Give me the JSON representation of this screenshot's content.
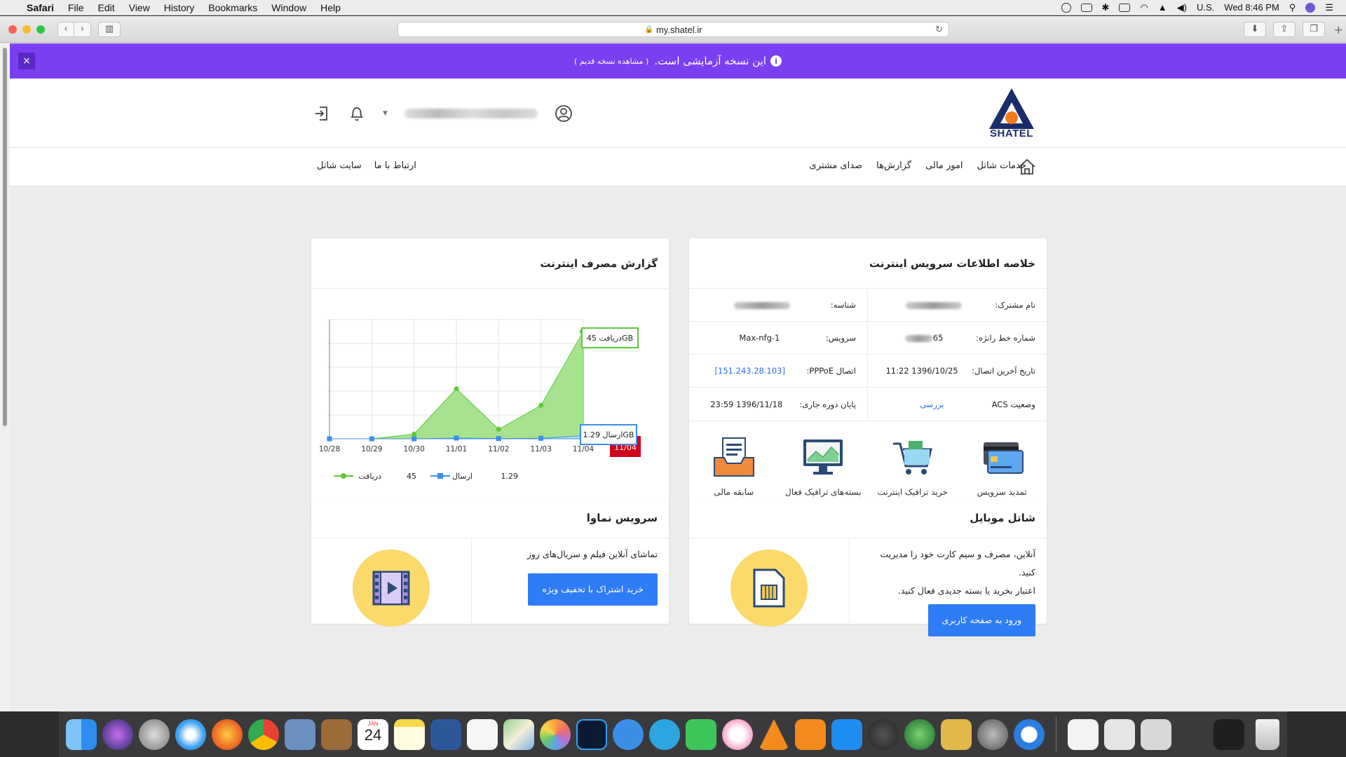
{
  "menubar": {
    "items": [
      "Safari",
      "File",
      "Edit",
      "View",
      "History",
      "Bookmarks",
      "Window",
      "Help"
    ],
    "input_source": "U.S.",
    "clock": "Wed 8:46 PM"
  },
  "browser": {
    "url": "my.shatel.ir"
  },
  "banner": {
    "text": "این نسخه آزمایشی است.",
    "old_version_link": "( مشاهده نسخه قدیم )",
    "close": "×"
  },
  "header": {
    "logo_text": "SHATEL"
  },
  "nav": {
    "main": [
      "خدمات شاتل",
      "امور مالی",
      "گزارش‌ها",
      "صدای مشتری"
    ],
    "side": [
      "ارتباط با ما",
      "سایت شاتل"
    ]
  },
  "service_info": {
    "title": "خلاصه اطلاعات سرویس اینترنت",
    "rows": [
      [
        {
          "label": "نام مشترک:",
          "value": ""
        },
        {
          "label": "شناسه:",
          "value": ""
        }
      ],
      [
        {
          "label": "شماره خط رانژه:",
          "value": "65"
        },
        {
          "label": "سرویس:",
          "value": "Max-nfg-1"
        }
      ],
      [
        {
          "label": "تاریخ آخرین اتصال:",
          "value": "1396/10/25 11:22"
        },
        {
          "label": "اتصال PPPoE:",
          "value": "[151.243.28.103]"
        }
      ],
      [
        {
          "label": "وضعیت ACS",
          "value": "بررسی"
        },
        {
          "label": "پایان دوره جاری:",
          "value": "1396/11/18 23:59"
        }
      ]
    ],
    "actions": [
      "تمدید سرویس",
      "خرید ترافیک اینترنت",
      "بسته‌های ترافیک فعال",
      "سابقه مالی"
    ]
  },
  "usage_report": {
    "title": "گزارش مصرف اینترنت",
    "tooltip_download": "دریافت 45GB",
    "tooltip_upload": "ارسال 1.29GB",
    "highlight_label": "11/04",
    "legend": [
      {
        "name": "دریافت",
        "value": "45"
      },
      {
        "name": "ارسال",
        "value": "1.29"
      }
    ]
  },
  "chart_data": {
    "type": "area",
    "categories": [
      "10/28",
      "10/29",
      "10/30",
      "11/01",
      "11/02",
      "11/03",
      "11/04"
    ],
    "series": [
      {
        "name": "دریافت",
        "values": [
          0,
          0,
          2,
          21,
          4,
          14,
          45
        ],
        "color": "#5cc93a"
      },
      {
        "name": "ارسال",
        "values": [
          0,
          0,
          0,
          0.3,
          0.1,
          0.2,
          1.29
        ],
        "color": "#3b8fe8"
      }
    ],
    "ylim": [
      0,
      50
    ],
    "grid": true
  },
  "mobile": {
    "title": "شاتل موبایل",
    "line1": "آنلاین، مصرف و سیم کارت خود را مدیریت کنید.",
    "line2": "اعتبار بخرید یا بسته جدیدی فعال کنید.",
    "button": "ورود به صفحه کاربری"
  },
  "namava": {
    "title": "سرویس نماوا",
    "line1": "تماشای آنلاین فیلم و سریال‌های روز",
    "button": "خرید اشتراک با تخفیف ویژه"
  },
  "dock": {
    "calendar_month": "JAN",
    "calendar_day": "24"
  },
  "colors": {
    "banner": "#7b3ff2",
    "accent": "#2e7cf6",
    "download": "#5cc93a",
    "upload": "#3b8fe8",
    "highlight": "#d0021b"
  }
}
